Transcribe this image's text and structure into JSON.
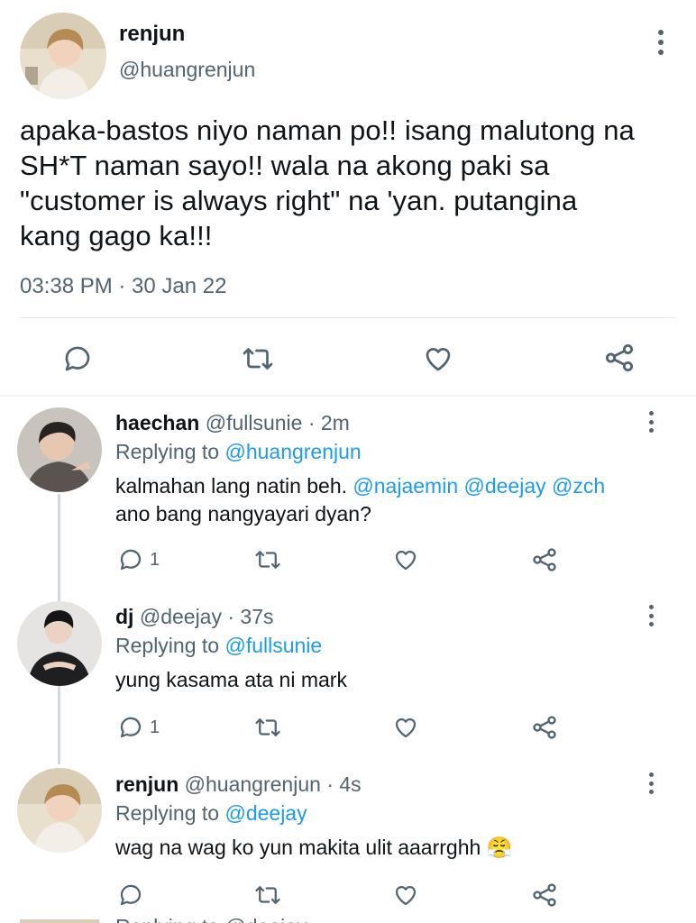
{
  "main_tweet": {
    "name": "renjun",
    "handle": "@huangrenjun",
    "text_lines": [
      "apaka-bastos niyo naman po!! isang malutong na",
      "SH*T naman sayo!! wala na akong paki sa",
      "\"customer is always right\" na 'yan. putangina",
      "kang gago ka!!!"
    ],
    "timestamp": "03:38 PM · 30 Jan 22"
  },
  "replies": [
    {
      "name": "haechan",
      "handle": "@fullsunie",
      "time": "· 2m",
      "replying_label": "Replying to",
      "replying_to": "@huangrenjun",
      "text_line1_prefix": "kalmahan lang natin beh.",
      "mentions": [
        "@najaemin",
        "@deejay",
        "@zch"
      ],
      "text_line2": "ano bang nangyayari dyan?",
      "reply_count": "1"
    },
    {
      "name": "dj",
      "handle": "@deejay",
      "time": "· 37s",
      "replying_label": "Replying to",
      "replying_to": "@fullsunie",
      "text": "yung kasama ata ni mark",
      "reply_count": "1"
    },
    {
      "name": "renjun",
      "handle": "@huangrenjun",
      "time": "· 4s",
      "replying_label": "Replying to",
      "replying_to": "@deejay",
      "text": "wag na wag ko yun makita ulit aaarrghh",
      "emoji": "😤"
    }
  ],
  "next_reply_partial": "Replying to @deejay",
  "icons": {
    "reply": "reply-icon",
    "retweet": "retweet-icon",
    "like": "like-icon",
    "share": "share-icon",
    "more": "more-icon"
  },
  "colors": {
    "link": "#1d9bf0",
    "secondary": "#536471",
    "text": "#0f1419"
  }
}
